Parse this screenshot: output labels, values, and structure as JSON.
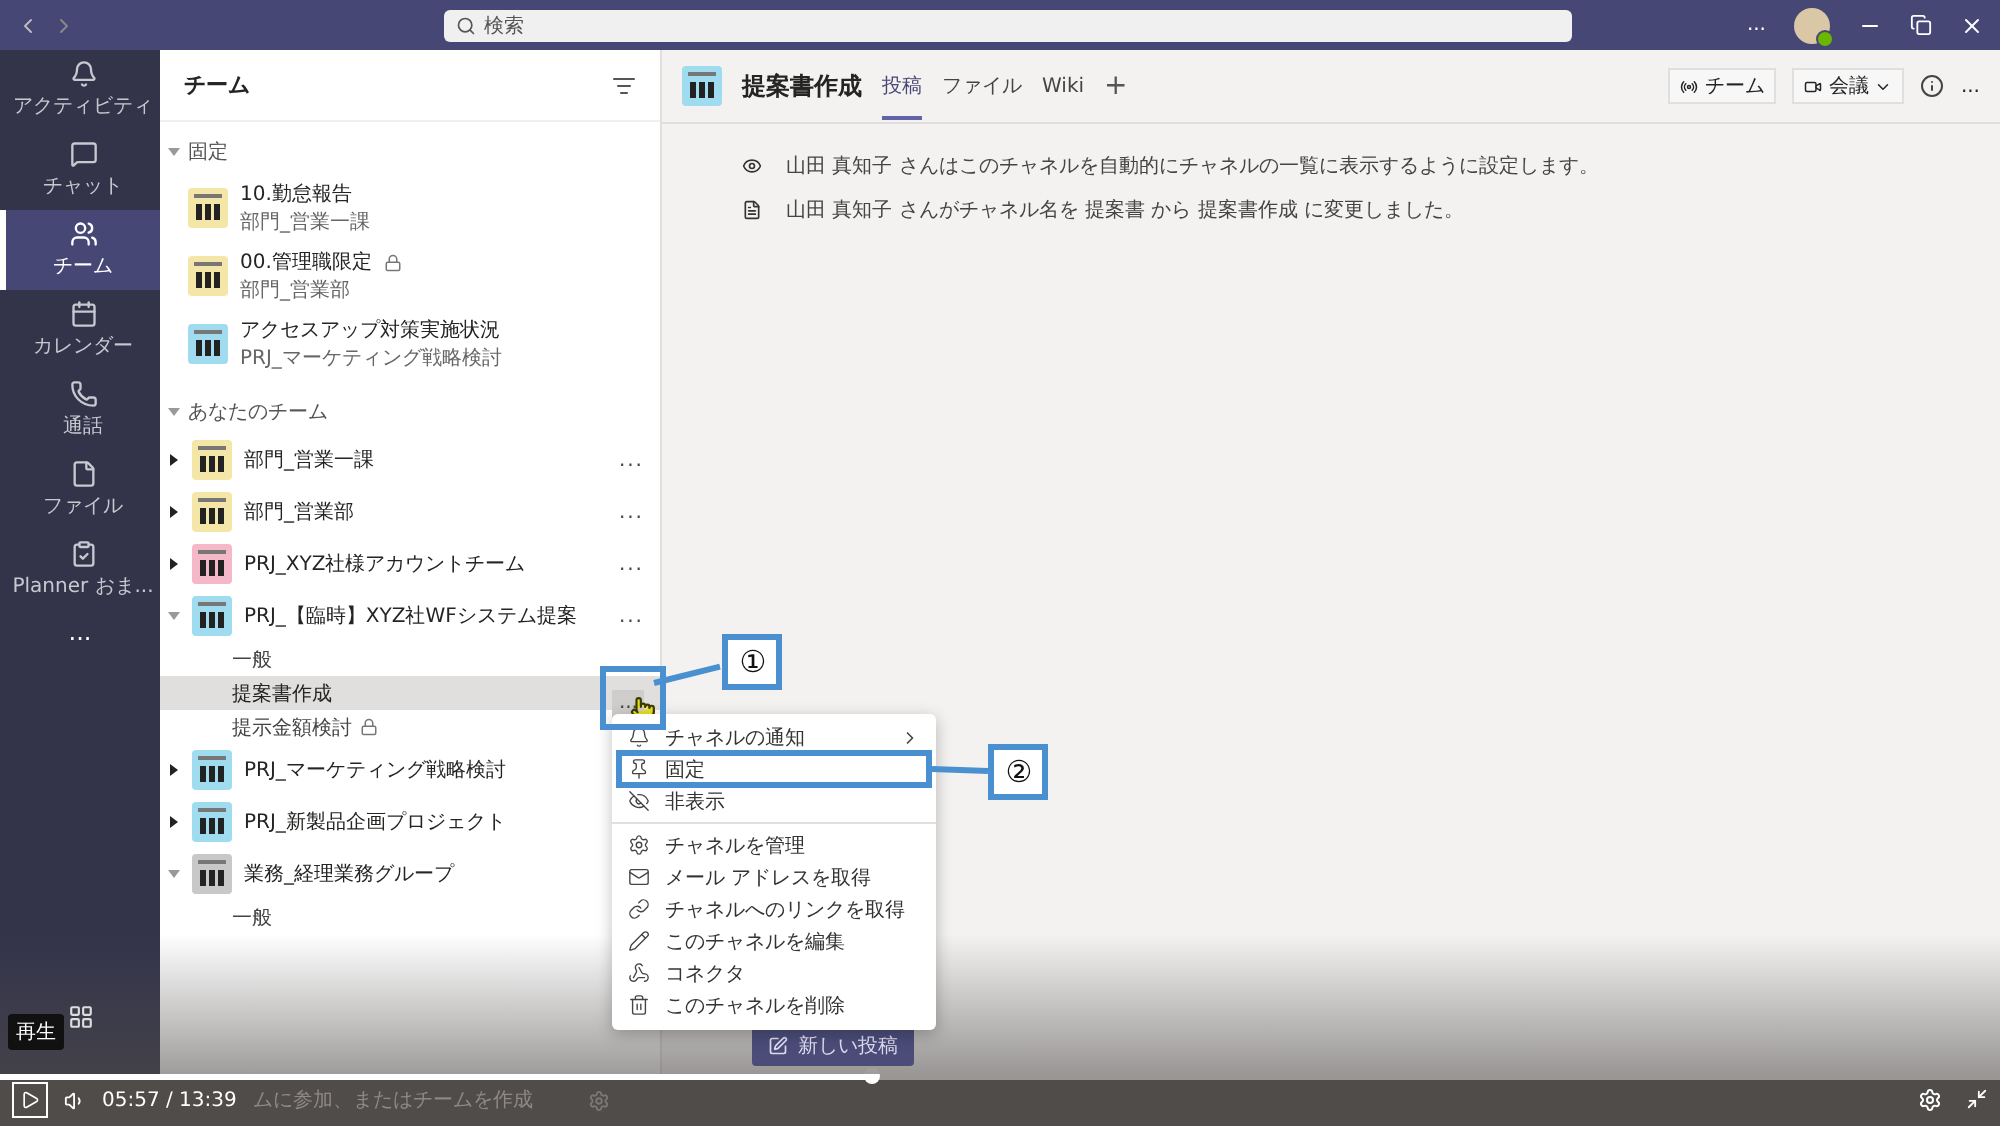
{
  "title_bar": {
    "search_placeholder": "検索",
    "more": "..."
  },
  "rail": {
    "items": [
      {
        "label": "アクティビティ",
        "selected": false
      },
      {
        "label": "チャット",
        "selected": false
      },
      {
        "label": "チーム",
        "selected": true
      },
      {
        "label": "カレンダー",
        "selected": false
      },
      {
        "label": "通話",
        "selected": false
      },
      {
        "label": "ファイル",
        "selected": false
      },
      {
        "label": "Planner おま...",
        "selected": false
      }
    ],
    "more": "..."
  },
  "teams_panel": {
    "title": "チーム",
    "pinned": {
      "heading": "固定",
      "items": [
        {
          "name": "10.勤怠報告",
          "team": "部門_営業一課",
          "locked": false,
          "color": "#f3e6a6"
        },
        {
          "name": "00.管理職限定",
          "team": "部門_営業部",
          "locked": true,
          "color": "#f3e6a6"
        },
        {
          "name": "アクセスアップ対策実施状況",
          "team": "PRJ_マーケティング戦略検討",
          "locked": false,
          "color": "#9fdcef"
        }
      ]
    },
    "your_teams": {
      "heading": "あなたのチーム",
      "teams": [
        {
          "name": "部門_営業一課",
          "color": "#f3e6a6",
          "expanded": false,
          "more": "..."
        },
        {
          "name": "部門_営業部",
          "color": "#f3e6a6",
          "expanded": false,
          "more": "..."
        },
        {
          "name": "PRJ_XYZ社様アカウントチーム",
          "color": "#f4b8c8",
          "expanded": false,
          "more": "..."
        },
        {
          "name": "PRJ_【臨時】XYZ社WFシステム提案",
          "color": "#9fdcef",
          "expanded": true,
          "more": "...",
          "channels": [
            {
              "name": "一般",
              "selected": false,
              "locked": false
            },
            {
              "name": "提案書作成",
              "selected": true,
              "locked": false,
              "more": "...",
              "callout": "①"
            },
            {
              "name": "提示金額検討",
              "selected": false,
              "locked": true
            }
          ]
        },
        {
          "name": "PRJ_マーケティング戦略検討",
          "color": "#9fdcef",
          "expanded": false
        },
        {
          "name": "PRJ_新製品企画プロジェクト",
          "color": "#9fdcef",
          "expanded": false
        },
        {
          "name": "業務_経理業務グループ",
          "color": "#c8c8c8",
          "expanded": true,
          "channels": [
            {
              "name": "一般",
              "selected": false,
              "locked": false
            }
          ]
        }
      ]
    },
    "footer": "ムに参加、またはチームを作成"
  },
  "channel": {
    "title": "提案書作成",
    "tabs": [
      {
        "label": "投稿",
        "selected": true
      },
      {
        "label": "ファイル",
        "selected": false
      },
      {
        "label": "Wiki",
        "selected": false
      }
    ],
    "add_tab": "+",
    "team_button": "チーム",
    "meet_button": "会議",
    "more": "...",
    "messages": [
      {
        "kind": "eye",
        "text": "山田 真知子 さんはこのチャネルを自動的にチャネルの一覧に表示するように設定します。"
      },
      {
        "kind": "rename",
        "text": "山田 真知子 さんがチャネル名を 提案書 から 提案書作成 に変更しました。"
      }
    ],
    "new_post": "新しい投稿"
  },
  "context_menu": {
    "items": [
      {
        "label": "チャネルの通知",
        "submenu": true,
        "divider_after": false
      },
      {
        "label": "固定",
        "submenu": false,
        "divider_after": false,
        "callout": "②"
      },
      {
        "label": "非表示",
        "submenu": false,
        "divider_after": true
      },
      {
        "label": "チャネルを管理",
        "submenu": false,
        "divider_after": false
      },
      {
        "label": "メール アドレスを取得",
        "submenu": false,
        "divider_after": false
      },
      {
        "label": "チャネルへのリンクを取得",
        "submenu": false,
        "divider_after": false
      },
      {
        "label": "このチャネルを編集",
        "submenu": false,
        "divider_after": false
      },
      {
        "label": "コネクタ",
        "submenu": false,
        "divider_after": false
      },
      {
        "label": "このチャネルを削除",
        "submenu": false,
        "divider_after": false
      }
    ]
  },
  "player": {
    "tooltip": "再生",
    "time": "05:57 / 13:39",
    "level": 0.436
  }
}
